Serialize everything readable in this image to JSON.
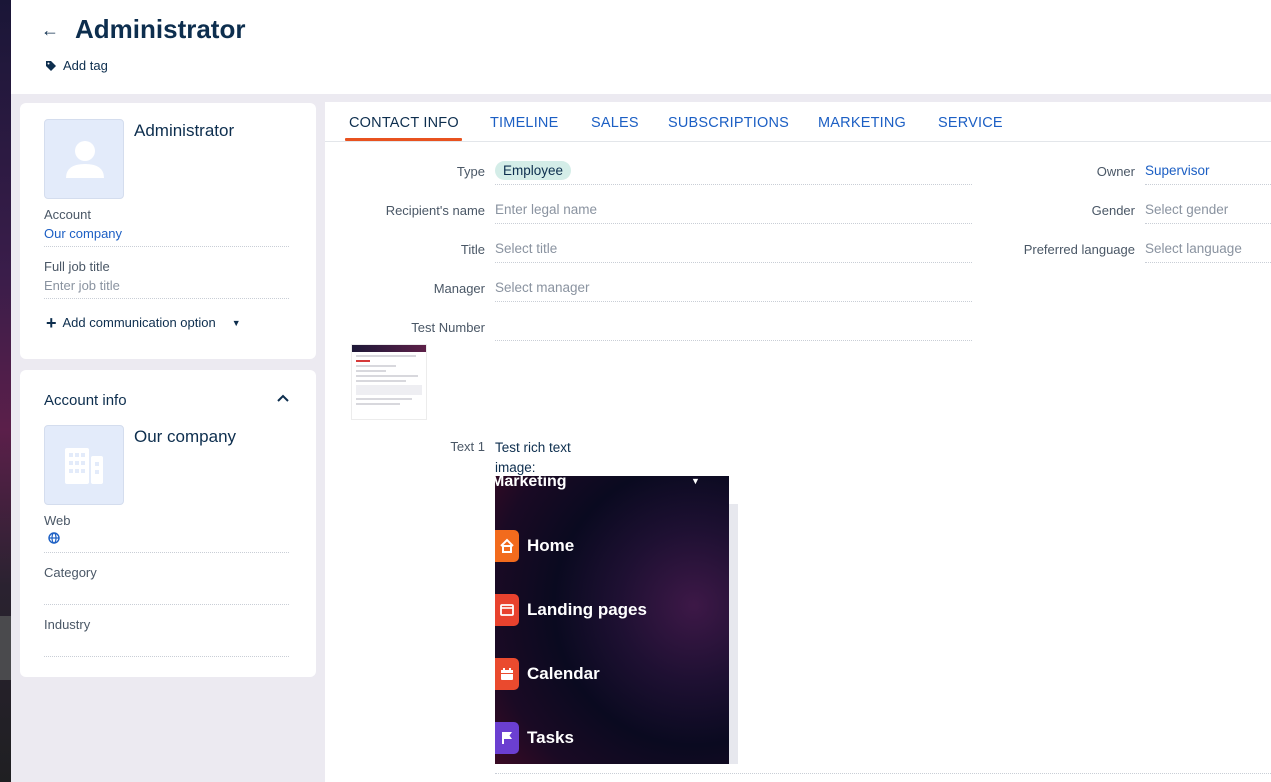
{
  "header": {
    "title": "Administrator",
    "add_tag": "Add tag"
  },
  "contact_card": {
    "name": "Administrator",
    "account_label": "Account",
    "account_value": "Our company",
    "job_title_label": "Full job title",
    "job_title_placeholder": "Enter job title",
    "add_communication": "Add communication option"
  },
  "account_card": {
    "section_title": "Account info",
    "name": "Our company",
    "web_label": "Web",
    "category_label": "Category",
    "industry_label": "Industry"
  },
  "tabs": [
    {
      "label": "CONTACT INFO",
      "active": true
    },
    {
      "label": "TIMELINE"
    },
    {
      "label": "SALES"
    },
    {
      "label": "SUBSCRIPTIONS"
    },
    {
      "label": "MARKETING"
    },
    {
      "label": "SERVICE"
    }
  ],
  "fields": {
    "type_label": "Type",
    "type_value": "Employee",
    "recipient_label": "Recipient's name",
    "recipient_placeholder": "Enter legal name",
    "title_label": "Title",
    "title_placeholder": "Select title",
    "manager_label": "Manager",
    "manager_placeholder": "Select manager",
    "test_number_label": "Test Number",
    "owner_label": "Owner",
    "owner_value": "Supervisor",
    "gender_label": "Gender",
    "gender_placeholder": "Select gender",
    "language_label": "Preferred language",
    "language_placeholder": "Select language",
    "text1_label": "Text 1",
    "text1_line1": "Test rich text",
    "text1_line2": "image:"
  },
  "embedded_menu": {
    "header": "Marketing",
    "items": [
      {
        "label": "Home",
        "color": "#f26b1d"
      },
      {
        "label": "Landing pages",
        "color": "#e8422e"
      },
      {
        "label": "Calendar",
        "color": "#ea4a2e"
      },
      {
        "label": "Tasks",
        "color": "#6b3fd1"
      }
    ]
  },
  "colors": {
    "accent": "#e8521f",
    "link": "#1c5fc4",
    "text": "#0d2e4e",
    "pill": "#d4ede8"
  }
}
